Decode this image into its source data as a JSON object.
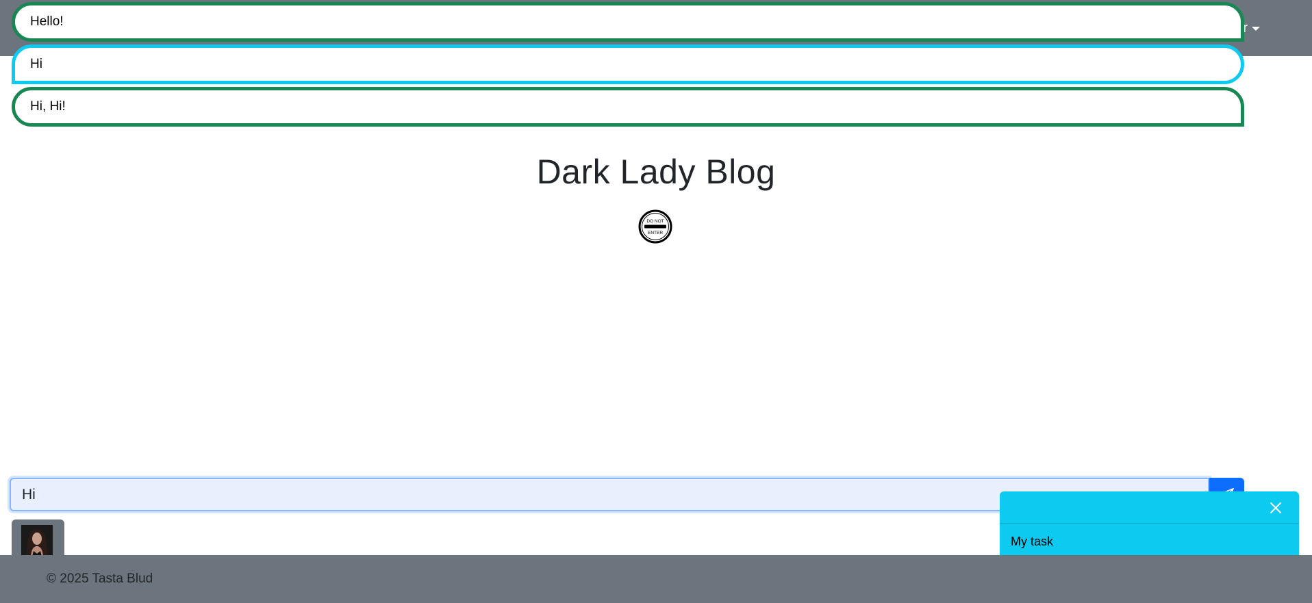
{
  "navbar": {
    "user_label": "User",
    "visible_fragment": "er"
  },
  "messages": [
    {
      "text": "Hello!",
      "author": "other"
    },
    {
      "text": "Hi",
      "author": "me"
    },
    {
      "text": "Hi, Hi!",
      "author": "other"
    }
  ],
  "blog": {
    "title": "Dark Lady Blog",
    "logo_text_top": "DO NOT",
    "logo_text_bottom": "ENTER"
  },
  "composer": {
    "value": "Hi",
    "send_icon": "send-icon"
  },
  "tasks_panel": {
    "close_icon": "close-icon",
    "items": [
      "My task"
    ]
  },
  "footer": {
    "copyright": "© 2025 Tasta Blud"
  },
  "colors": {
    "navbar": "#6c757d",
    "received_border": "#198754",
    "sent_border": "#0dcaf0",
    "send_button": "#0d6efd",
    "tasks_panel": "#0dcaf0",
    "input_bg": "#e8f0fe"
  }
}
